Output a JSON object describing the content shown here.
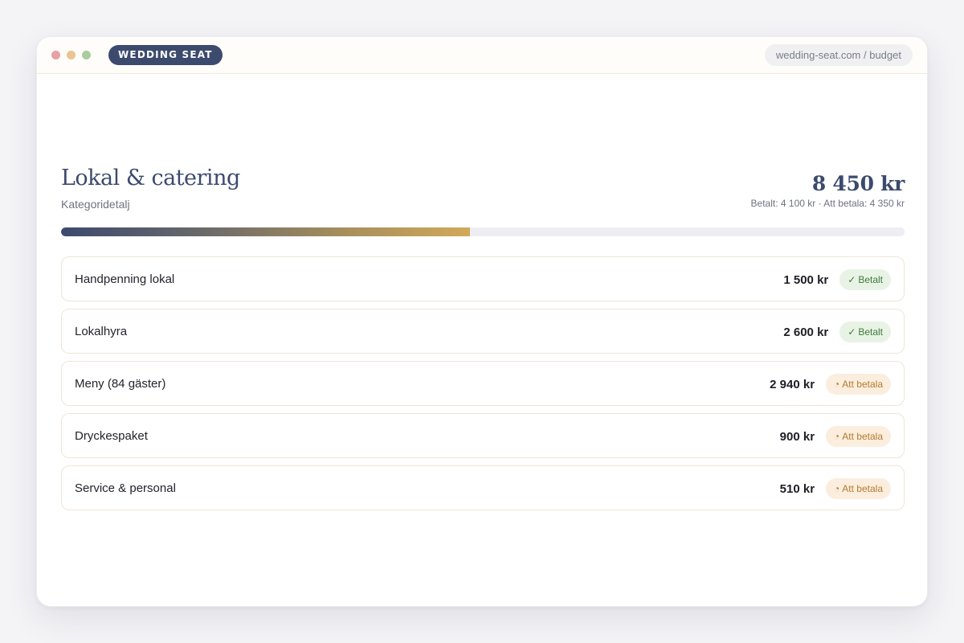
{
  "app": {
    "brand": "WEDDING SEAT",
    "url": "wedding-seat.com / budget"
  },
  "category": {
    "title": "Lokal & catering",
    "subtitle": "Kategoridetalj",
    "total": "8 450 kr",
    "summary": "Betalt: 4 100 kr · Att betala: 4 350 kr",
    "progress_fraction": 0.485
  },
  "items": [
    {
      "name": "Handpenning lokal",
      "amount": "1 500 kr",
      "status": "Betalt",
      "status_icon": "✓",
      "state": "paid"
    },
    {
      "name": "Lokalhyra",
      "amount": "2 600 kr",
      "status": "Betalt",
      "status_icon": "✓",
      "state": "paid"
    },
    {
      "name": "Meny (84 gäster)",
      "amount": "2 940 kr",
      "status": "Att betala",
      "status_icon": "◔",
      "state": "due"
    },
    {
      "name": "Dryckespaket",
      "amount": "900 kr",
      "status": "Att betala",
      "status_icon": "◔",
      "state": "due"
    },
    {
      "name": "Service & personal",
      "amount": "510 kr",
      "status": "Att betala",
      "status_icon": "◔",
      "state": "due"
    }
  ],
  "colors": {
    "primary": "#3c4a6e",
    "gold": "#d1a95a",
    "paid_bg": "#e8f3e5",
    "paid_fg": "#3d7a3c",
    "due_bg": "#fbeede",
    "due_fg": "#b57a2e"
  }
}
